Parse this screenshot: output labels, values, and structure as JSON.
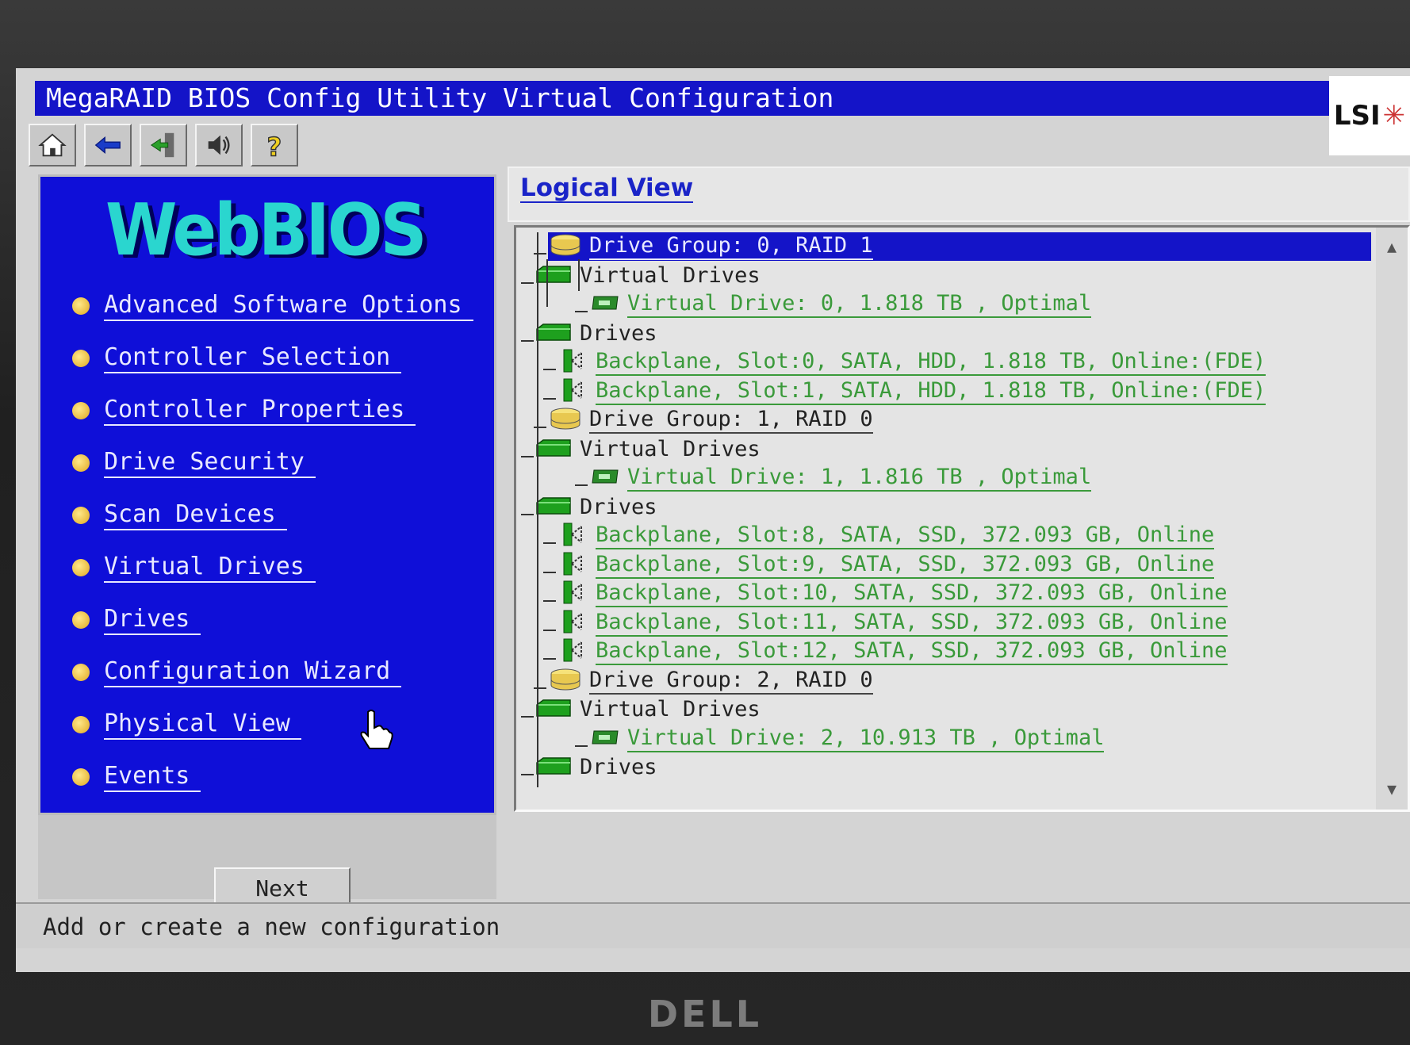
{
  "window": {
    "title": "MegaRAID BIOS Config Utility Virtual Configuration",
    "brand_logo": "LSI",
    "monitor_brand": "DELL"
  },
  "toolbar": {
    "icons": [
      "home-icon",
      "back-arrow-icon",
      "exit-icon",
      "speaker-icon",
      "help-icon"
    ]
  },
  "sidebar": {
    "logo": "WebBIOS",
    "items": [
      {
        "label": "Advanced Software Options"
      },
      {
        "label": "Controller Selection"
      },
      {
        "label": "Controller Properties"
      },
      {
        "label": "Drive Security"
      },
      {
        "label": "Scan Devices"
      },
      {
        "label": "Virtual Drives"
      },
      {
        "label": "Drives"
      },
      {
        "label": "Configuration Wizard"
      },
      {
        "label": "Physical View"
      },
      {
        "label": "Events"
      }
    ],
    "next_label": "Next"
  },
  "logical_view": {
    "title": "Logical View",
    "rows": [
      {
        "type": "group",
        "label": "Drive Group: 0, RAID 1",
        "selected": true
      },
      {
        "type": "folder",
        "label": "Virtual Drives"
      },
      {
        "type": "vd",
        "label": "Virtual Drive: 0, 1.818 TB , Optimal"
      },
      {
        "type": "folder",
        "label": "Drives"
      },
      {
        "type": "pd",
        "label": "Backplane, Slot:0, SATA, HDD, 1.818 TB, Online:(FDE)"
      },
      {
        "type": "pd",
        "label": "Backplane, Slot:1, SATA, HDD, 1.818 TB, Online:(FDE)"
      },
      {
        "type": "group",
        "label": "Drive Group: 1, RAID 0"
      },
      {
        "type": "folder",
        "label": "Virtual Drives"
      },
      {
        "type": "vd",
        "label": "Virtual Drive: 1, 1.816 TB , Optimal"
      },
      {
        "type": "folder",
        "label": "Drives"
      },
      {
        "type": "pd",
        "label": "Backplane, Slot:8, SATA, SSD, 372.093 GB, Online"
      },
      {
        "type": "pd",
        "label": "Backplane, Slot:9, SATA, SSD, 372.093 GB, Online"
      },
      {
        "type": "pd",
        "label": "Backplane, Slot:10, SATA, SSD, 372.093 GB, Online"
      },
      {
        "type": "pd",
        "label": "Backplane, Slot:11, SATA, SSD, 372.093 GB, Online"
      },
      {
        "type": "pd",
        "label": "Backplane, Slot:12, SATA, SSD, 372.093 GB, Online"
      },
      {
        "type": "group",
        "label": "Drive Group: 2, RAID 0"
      },
      {
        "type": "folder",
        "label": "Virtual Drives"
      },
      {
        "type": "vd",
        "label": "Virtual Drive: 2, 10.913 TB , Optimal"
      },
      {
        "type": "folder",
        "label": "Drives"
      }
    ]
  },
  "status": {
    "text": "Add or create a new configuration"
  },
  "colors": {
    "title_bar": "#1414c8",
    "sidebar_bg": "#0f0fd8",
    "tree_link": "#3a9a3a",
    "logo": "#2ad6cf"
  }
}
